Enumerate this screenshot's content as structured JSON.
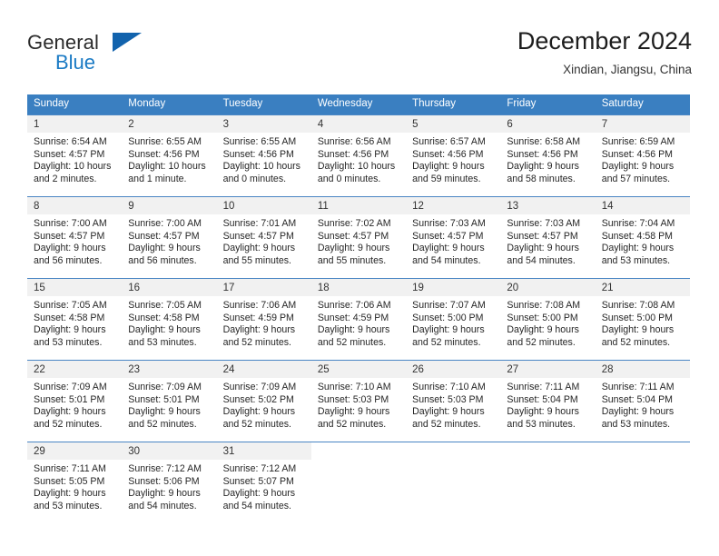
{
  "brand": {
    "name_part1": "General",
    "name_part2": "Blue",
    "accent_color": "#1a7ac4",
    "triangle_color": "#1263ad"
  },
  "header": {
    "title": "December 2024",
    "subtitle": "Xindian, Jiangsu, China"
  },
  "calendar": {
    "header_bg": "#3a7fc1",
    "weekdays": [
      "Sunday",
      "Monday",
      "Tuesday",
      "Wednesday",
      "Thursday",
      "Friday",
      "Saturday"
    ],
    "weeks": [
      {
        "days": [
          {
            "num": "1",
            "sunrise": "Sunrise: 6:54 AM",
            "sunset": "Sunset: 4:57 PM",
            "daylight": "Daylight: 10 hours and 2 minutes."
          },
          {
            "num": "2",
            "sunrise": "Sunrise: 6:55 AM",
            "sunset": "Sunset: 4:56 PM",
            "daylight": "Daylight: 10 hours and 1 minute."
          },
          {
            "num": "3",
            "sunrise": "Sunrise: 6:55 AM",
            "sunset": "Sunset: 4:56 PM",
            "daylight": "Daylight: 10 hours and 0 minutes."
          },
          {
            "num": "4",
            "sunrise": "Sunrise: 6:56 AM",
            "sunset": "Sunset: 4:56 PM",
            "daylight": "Daylight: 10 hours and 0 minutes."
          },
          {
            "num": "5",
            "sunrise": "Sunrise: 6:57 AM",
            "sunset": "Sunset: 4:56 PM",
            "daylight": "Daylight: 9 hours and 59 minutes."
          },
          {
            "num": "6",
            "sunrise": "Sunrise: 6:58 AM",
            "sunset": "Sunset: 4:56 PM",
            "daylight": "Daylight: 9 hours and 58 minutes."
          },
          {
            "num": "7",
            "sunrise": "Sunrise: 6:59 AM",
            "sunset": "Sunset: 4:56 PM",
            "daylight": "Daylight: 9 hours and 57 minutes."
          }
        ]
      },
      {
        "days": [
          {
            "num": "8",
            "sunrise": "Sunrise: 7:00 AM",
            "sunset": "Sunset: 4:57 PM",
            "daylight": "Daylight: 9 hours and 56 minutes."
          },
          {
            "num": "9",
            "sunrise": "Sunrise: 7:00 AM",
            "sunset": "Sunset: 4:57 PM",
            "daylight": "Daylight: 9 hours and 56 minutes."
          },
          {
            "num": "10",
            "sunrise": "Sunrise: 7:01 AM",
            "sunset": "Sunset: 4:57 PM",
            "daylight": "Daylight: 9 hours and 55 minutes."
          },
          {
            "num": "11",
            "sunrise": "Sunrise: 7:02 AM",
            "sunset": "Sunset: 4:57 PM",
            "daylight": "Daylight: 9 hours and 55 minutes."
          },
          {
            "num": "12",
            "sunrise": "Sunrise: 7:03 AM",
            "sunset": "Sunset: 4:57 PM",
            "daylight": "Daylight: 9 hours and 54 minutes."
          },
          {
            "num": "13",
            "sunrise": "Sunrise: 7:03 AM",
            "sunset": "Sunset: 4:57 PM",
            "daylight": "Daylight: 9 hours and 54 minutes."
          },
          {
            "num": "14",
            "sunrise": "Sunrise: 7:04 AM",
            "sunset": "Sunset: 4:58 PM",
            "daylight": "Daylight: 9 hours and 53 minutes."
          }
        ]
      },
      {
        "days": [
          {
            "num": "15",
            "sunrise": "Sunrise: 7:05 AM",
            "sunset": "Sunset: 4:58 PM",
            "daylight": "Daylight: 9 hours and 53 minutes."
          },
          {
            "num": "16",
            "sunrise": "Sunrise: 7:05 AM",
            "sunset": "Sunset: 4:58 PM",
            "daylight": "Daylight: 9 hours and 53 minutes."
          },
          {
            "num": "17",
            "sunrise": "Sunrise: 7:06 AM",
            "sunset": "Sunset: 4:59 PM",
            "daylight": "Daylight: 9 hours and 52 minutes."
          },
          {
            "num": "18",
            "sunrise": "Sunrise: 7:06 AM",
            "sunset": "Sunset: 4:59 PM",
            "daylight": "Daylight: 9 hours and 52 minutes."
          },
          {
            "num": "19",
            "sunrise": "Sunrise: 7:07 AM",
            "sunset": "Sunset: 5:00 PM",
            "daylight": "Daylight: 9 hours and 52 minutes."
          },
          {
            "num": "20",
            "sunrise": "Sunrise: 7:08 AM",
            "sunset": "Sunset: 5:00 PM",
            "daylight": "Daylight: 9 hours and 52 minutes."
          },
          {
            "num": "21",
            "sunrise": "Sunrise: 7:08 AM",
            "sunset": "Sunset: 5:00 PM",
            "daylight": "Daylight: 9 hours and 52 minutes."
          }
        ]
      },
      {
        "days": [
          {
            "num": "22",
            "sunrise": "Sunrise: 7:09 AM",
            "sunset": "Sunset: 5:01 PM",
            "daylight": "Daylight: 9 hours and 52 minutes."
          },
          {
            "num": "23",
            "sunrise": "Sunrise: 7:09 AM",
            "sunset": "Sunset: 5:01 PM",
            "daylight": "Daylight: 9 hours and 52 minutes."
          },
          {
            "num": "24",
            "sunrise": "Sunrise: 7:09 AM",
            "sunset": "Sunset: 5:02 PM",
            "daylight": "Daylight: 9 hours and 52 minutes."
          },
          {
            "num": "25",
            "sunrise": "Sunrise: 7:10 AM",
            "sunset": "Sunset: 5:03 PM",
            "daylight": "Daylight: 9 hours and 52 minutes."
          },
          {
            "num": "26",
            "sunrise": "Sunrise: 7:10 AM",
            "sunset": "Sunset: 5:03 PM",
            "daylight": "Daylight: 9 hours and 52 minutes."
          },
          {
            "num": "27",
            "sunrise": "Sunrise: 7:11 AM",
            "sunset": "Sunset: 5:04 PM",
            "daylight": "Daylight: 9 hours and 53 minutes."
          },
          {
            "num": "28",
            "sunrise": "Sunrise: 7:11 AM",
            "sunset": "Sunset: 5:04 PM",
            "daylight": "Daylight: 9 hours and 53 minutes."
          }
        ]
      },
      {
        "days": [
          {
            "num": "29",
            "sunrise": "Sunrise: 7:11 AM",
            "sunset": "Sunset: 5:05 PM",
            "daylight": "Daylight: 9 hours and 53 minutes."
          },
          {
            "num": "30",
            "sunrise": "Sunrise: 7:12 AM",
            "sunset": "Sunset: 5:06 PM",
            "daylight": "Daylight: 9 hours and 54 minutes."
          },
          {
            "num": "31",
            "sunrise": "Sunrise: 7:12 AM",
            "sunset": "Sunset: 5:07 PM",
            "daylight": "Daylight: 9 hours and 54 minutes."
          },
          {
            "num": "",
            "sunrise": "",
            "sunset": "",
            "daylight": ""
          },
          {
            "num": "",
            "sunrise": "",
            "sunset": "",
            "daylight": ""
          },
          {
            "num": "",
            "sunrise": "",
            "sunset": "",
            "daylight": ""
          },
          {
            "num": "",
            "sunrise": "",
            "sunset": "",
            "daylight": ""
          }
        ]
      }
    ]
  }
}
